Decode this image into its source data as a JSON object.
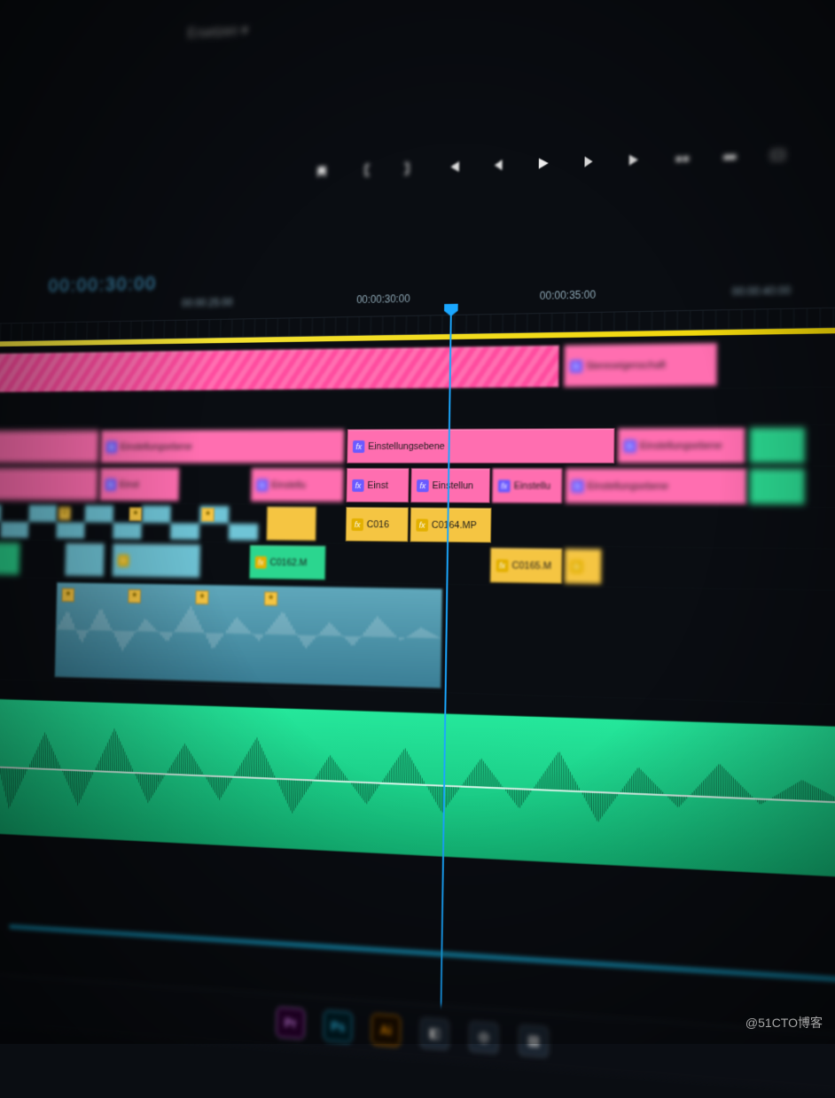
{
  "menu": {
    "dropdown_label": "Ersetzen"
  },
  "timecode": {
    "current": "00:00:30:00"
  },
  "ruler": {
    "t0": "00:00:25:00",
    "t1": "00:00:30:00",
    "t2": "00:00:35:00",
    "t3": "00:00:40:00"
  },
  "transport": {
    "mark_in": "mark-in",
    "bracket_open": "set-in",
    "bracket_close": "set-out",
    "go_in": "go-to-in",
    "step_back": "step-back",
    "play": "play",
    "step_fwd": "step-forward",
    "go_out": "go-to-out",
    "insert": "insert",
    "overwrite": "overwrite",
    "export": "export-frame"
  },
  "clips": {
    "adj_layer": "Einstellungsebene",
    "adj_layer_short": "Einst",
    "adj_layer_mid": "Einstellun",
    "adj_layer_trail": "Einstellu",
    "c016": "C016",
    "c0164": "C0164.MP",
    "c0162": "C0162.M",
    "c0165": "C0165.M",
    "stereo_label": "Stereoeigenschaft"
  },
  "taskbar": {
    "pr": "Pr",
    "ps": "Ps",
    "ai": "Ai"
  },
  "watermark": "@51CTO博客"
}
